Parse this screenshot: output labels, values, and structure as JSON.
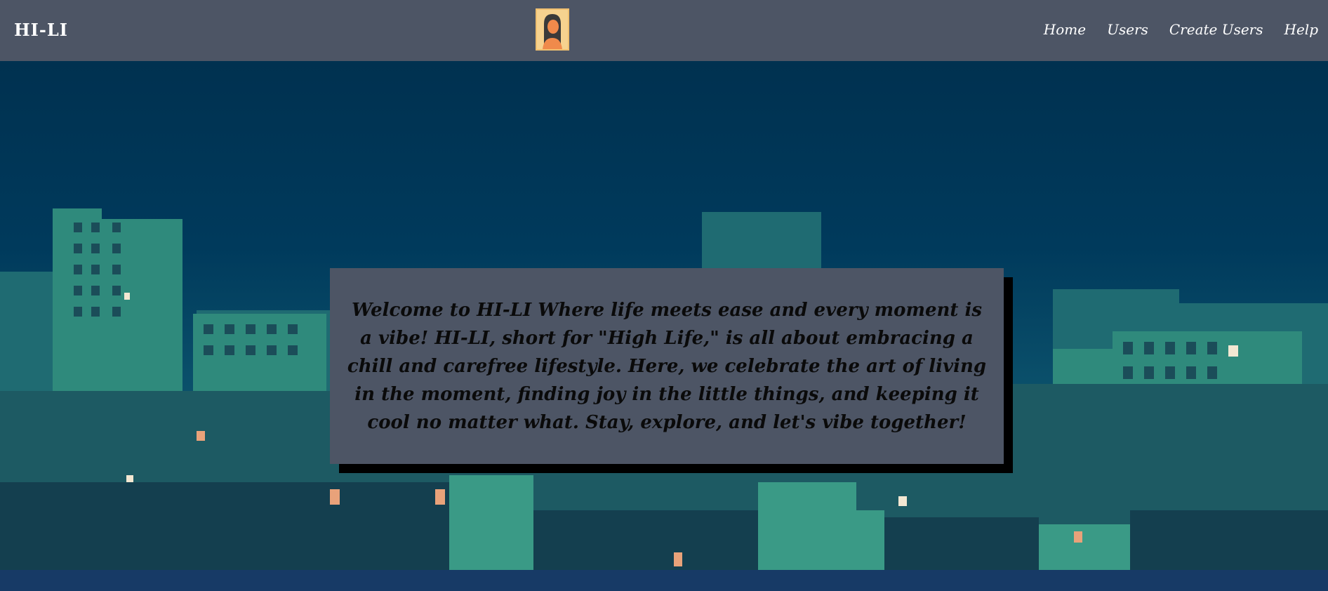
{
  "navbar": {
    "brand": "HI-LI",
    "avatar_icon": "portrait-avatar-icon",
    "links": [
      {
        "label": "Home"
      },
      {
        "label": "Users"
      },
      {
        "label": "Create Users"
      },
      {
        "label": "Help"
      }
    ]
  },
  "hero": {
    "background": "night-city-skyline-image",
    "welcome_text": "Welcome to HI-LI Where life meets ease and every moment is a vibe! HI-LI, short for \"High Life,\" is all about embracing a chill and carefree lifestyle. Here, we celebrate the art of living in the moment, finding joy in the little things, and keeping it cool no matter what. Stay, explore, and let's vibe together!"
  },
  "colors": {
    "navbar_bg": "#4d5565",
    "sky": "#003150",
    "building_teal": "#2f8a7c",
    "box_bg": "#4d5565",
    "box_shadow": "#000000",
    "avatar_frame": "#f0c070"
  }
}
